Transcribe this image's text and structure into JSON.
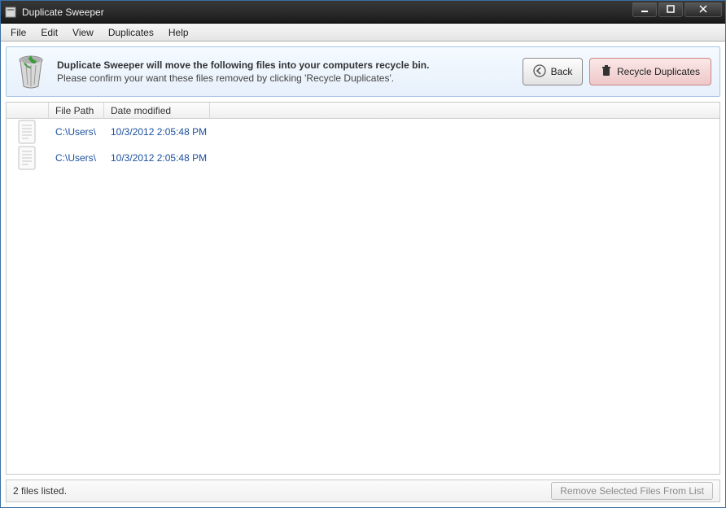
{
  "window": {
    "title": "Duplicate Sweeper"
  },
  "menu": {
    "items": [
      "File",
      "Edit",
      "View",
      "Duplicates",
      "Help"
    ]
  },
  "info": {
    "line1": "Duplicate Sweeper will move the following files into your computers recycle bin.",
    "line2": "Please confirm your want these files removed by clicking 'Recycle Duplicates'."
  },
  "buttons": {
    "back": "Back",
    "recycle": "Recycle Duplicates",
    "remove": "Remove Selected Files From List"
  },
  "columns": {
    "path": "File Path",
    "date": "Date modified"
  },
  "files": [
    {
      "path": "C:\\Users\\",
      "date": "10/3/2012 2:05:48 PM"
    },
    {
      "path": "C:\\Users\\",
      "date": "10/3/2012 2:05:48 PM"
    }
  ],
  "status": {
    "count": "2 files listed."
  }
}
